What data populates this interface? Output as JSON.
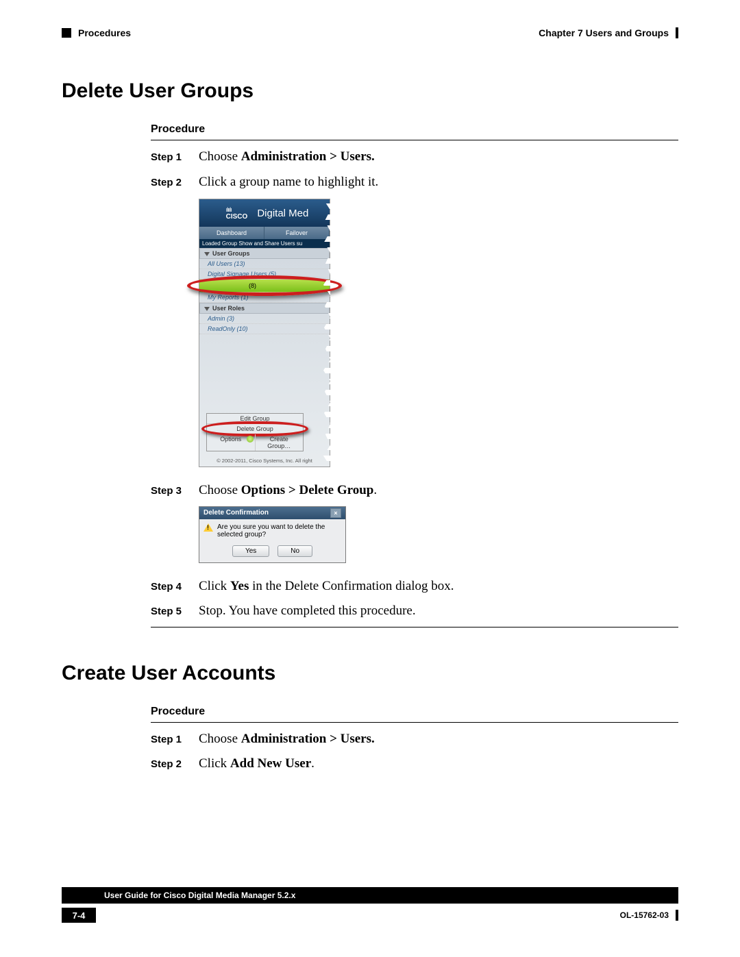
{
  "header": {
    "breadcrumb": "Procedures",
    "chapter": "Chapter 7    Users and Groups"
  },
  "section1": {
    "heading": "Delete User Groups",
    "procedure_label": "Procedure",
    "steps": {
      "s1_label": "Step 1",
      "s1_prefix": "Choose ",
      "s1_bold": "Administration > Users.",
      "s2_label": "Step 2",
      "s2_text": "Click a group name to highlight it.",
      "s3_label": "Step 3",
      "s3_prefix": "Choose ",
      "s3_bold": "Options > Delete Group",
      "s3_suffix": ".",
      "s4_label": "Step 4",
      "s4_prefix": "Click ",
      "s4_bold": "Yes",
      "s4_suffix": " in the Delete Confirmation dialog box.",
      "s5_label": "Step 5",
      "s5_text": "Stop. You have completed this procedure."
    }
  },
  "screenshot1": {
    "brand_bars": "ılıılı",
    "brand_name": "CISCO",
    "title": "Digital Med",
    "tab1": "Dashboard",
    "tab2": "Failover",
    "loaded": "Loaded Group Show and Share Users su",
    "user_groups": "User Groups",
    "all_users": "All Users (13)",
    "dsu": "Digital Signage Users (5)",
    "selected": "(8)",
    "my_reports": "My Reports (1)",
    "user_roles": "User Roles",
    "admin": "Admin (3)",
    "readonly": "ReadOnly (10)",
    "edit_group": "Edit Group",
    "delete_group": "Delete Group",
    "options": "Options",
    "create_group": "Create Group…",
    "copyright": "© 2002-2011, Cisco Systems, Inc. All right"
  },
  "screenshot2": {
    "title": "Delete Confirmation",
    "message": "Are you sure you want to delete the selected group?",
    "yes": "Yes",
    "no": "No"
  },
  "section2": {
    "heading": "Create User Accounts",
    "procedure_label": "Procedure",
    "steps": {
      "s1_label": "Step 1",
      "s1_prefix": "Choose ",
      "s1_bold": "Administration > Users.",
      "s2_label": "Step 2",
      "s2_prefix": "Click ",
      "s2_bold": "Add New User",
      "s2_suffix": "."
    }
  },
  "footer": {
    "guide": "User Guide for Cisco Digital Media Manager 5.2.x",
    "page": "7-4",
    "docnum": "OL-15762-03"
  }
}
